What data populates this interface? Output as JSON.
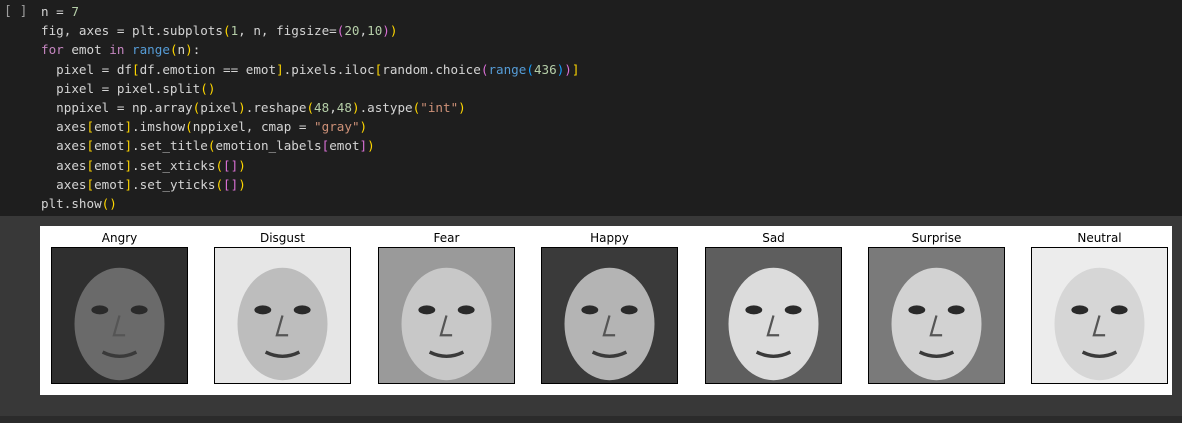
{
  "cell": {
    "run_label": "[ ]",
    "code_lines": [
      [
        {
          "t": "n = "
        },
        {
          "t": "7",
          "c": "num"
        }
      ],
      [
        {
          "t": "fig, axes = plt.subplots"
        },
        {
          "t": "(",
          "c": "p1"
        },
        {
          "t": "1",
          "c": "num"
        },
        {
          "t": ", n, figsize="
        },
        {
          "t": "(",
          "c": "p2"
        },
        {
          "t": "20",
          "c": "num"
        },
        {
          "t": ","
        },
        {
          "t": "10",
          "c": "num"
        },
        {
          "t": ")",
          "c": "p2"
        },
        {
          "t": ")",
          "c": "p1"
        }
      ],
      [
        {
          "t": "for",
          "c": "kw"
        },
        {
          "t": " emot "
        },
        {
          "t": "in",
          "c": "kw"
        },
        {
          "t": " "
        },
        {
          "t": "range",
          "c": "bi"
        },
        {
          "t": "(",
          "c": "p1"
        },
        {
          "t": "n"
        },
        {
          "t": ")",
          "c": "p1"
        },
        {
          "t": ":"
        }
      ],
      [
        {
          "t": "  pixel = df"
        },
        {
          "t": "[",
          "c": "p1"
        },
        {
          "t": "df.emotion == emot"
        },
        {
          "t": "]",
          "c": "p1"
        },
        {
          "t": ".pixels.iloc"
        },
        {
          "t": "[",
          "c": "p1"
        },
        {
          "t": "random.choice"
        },
        {
          "t": "(",
          "c": "p2"
        },
        {
          "t": "range",
          "c": "bi"
        },
        {
          "t": "(",
          "c": "p3"
        },
        {
          "t": "436",
          "c": "num"
        },
        {
          "t": ")",
          "c": "p3"
        },
        {
          "t": ")",
          "c": "p2"
        },
        {
          "t": "]",
          "c": "p1"
        }
      ],
      [
        {
          "t": "  pixel = pixel.split"
        },
        {
          "t": "()",
          "c": "p1"
        }
      ],
      [
        {
          "t": "  nppixel = np.array"
        },
        {
          "t": "(",
          "c": "p1"
        },
        {
          "t": "pixel"
        },
        {
          "t": ")",
          "c": "p1"
        },
        {
          "t": ".reshape"
        },
        {
          "t": "(",
          "c": "p1"
        },
        {
          "t": "48",
          "c": "num"
        },
        {
          "t": ","
        },
        {
          "t": "48",
          "c": "num"
        },
        {
          "t": ")",
          "c": "p1"
        },
        {
          "t": ".astype"
        },
        {
          "t": "(",
          "c": "p1"
        },
        {
          "t": "\"int\"",
          "c": "str"
        },
        {
          "t": ")",
          "c": "p1"
        }
      ],
      [
        {
          "t": "  axes"
        },
        {
          "t": "[",
          "c": "p1"
        },
        {
          "t": "emot"
        },
        {
          "t": "]",
          "c": "p1"
        },
        {
          "t": ".imshow"
        },
        {
          "t": "(",
          "c": "p1"
        },
        {
          "t": "nppixel, cmap = "
        },
        {
          "t": "\"gray\"",
          "c": "str"
        },
        {
          "t": ")",
          "c": "p1"
        }
      ],
      [
        {
          "t": "  axes"
        },
        {
          "t": "[",
          "c": "p1"
        },
        {
          "t": "emot"
        },
        {
          "t": "]",
          "c": "p1"
        },
        {
          "t": ".set_title"
        },
        {
          "t": "(",
          "c": "p1"
        },
        {
          "t": "emotion_labels"
        },
        {
          "t": "[",
          "c": "p2"
        },
        {
          "t": "emot"
        },
        {
          "t": "]",
          "c": "p2"
        },
        {
          "t": ")",
          "c": "p1"
        }
      ],
      [
        {
          "t": "  axes"
        },
        {
          "t": "[",
          "c": "p1"
        },
        {
          "t": "emot"
        },
        {
          "t": "]",
          "c": "p1"
        },
        {
          "t": ".set_xticks"
        },
        {
          "t": "(",
          "c": "p1"
        },
        {
          "t": "[]",
          "c": "p2"
        },
        {
          "t": ")",
          "c": "p1"
        }
      ],
      [
        {
          "t": "  axes"
        },
        {
          "t": "[",
          "c": "p1"
        },
        {
          "t": "emot"
        },
        {
          "t": "]",
          "c": "p1"
        },
        {
          "t": ".set_yticks"
        },
        {
          "t": "(",
          "c": "p1"
        },
        {
          "t": "[]",
          "c": "p2"
        },
        {
          "t": ")",
          "c": "p1"
        }
      ],
      [
        {
          "t": "plt.show"
        },
        {
          "t": "()",
          "c": "p1"
        }
      ]
    ]
  },
  "output": {
    "panels": [
      {
        "title": "Angry",
        "tone": "#2f2f2f",
        "face": "#6a6a6a"
      },
      {
        "title": "Disgust",
        "tone": "#e6e6e6",
        "face": "#bdbdbd"
      },
      {
        "title": "Fear",
        "tone": "#9a9a9a",
        "face": "#c8c8c8"
      },
      {
        "title": "Happy",
        "tone": "#3a3a3a",
        "face": "#b4b4b4"
      },
      {
        "title": "Sad",
        "tone": "#5e5e5e",
        "face": "#dcdcdc"
      },
      {
        "title": "Surprise",
        "tone": "#7a7a7a",
        "face": "#d2d2d2"
      },
      {
        "title": "Neutral",
        "tone": "#ececec",
        "face": "#d6d6d6"
      }
    ]
  },
  "colors": {
    "editor_bg": "#1e1e1e",
    "output_bg": "#383838",
    "figure_bg": "#ffffff"
  }
}
